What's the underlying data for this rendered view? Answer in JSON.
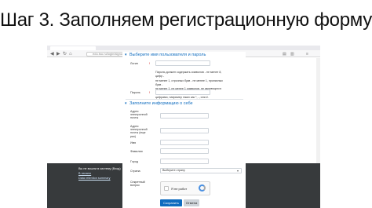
{
  "slide": {
    "title": "Шаг 3. Заполняем регистрационную форму"
  },
  "browser": {
    "url": "edu.tsu.ru/login/signup.php"
  },
  "sidebar": {
    "lines": [
      "Вы не вошли в систему (Вход)",
      "В начало",
      "Data retention summary"
    ]
  },
  "form": {
    "section1_title": "Выберите имя пользователя и пароль",
    "login_label": "Логин",
    "password_rules": [
      "Пароль должен содержать символов - не менее 8, цифр -",
      "не менее 1, строчных букв - не менее 1, прописных букв -",
      "не менее 1, не менее 1 символов, не являющихся буквами и",
      "цифрами, например таких как *, -, или #."
    ],
    "password_label": "Пароль",
    "section2_title": "Заполните информацию о себе",
    "email_label": "Адрес электронной почты",
    "email2_label": "Адрес электронной почты (еще раз)",
    "firstname_label": "Имя",
    "lastname_label": "Фамилия",
    "city_label": "Город",
    "country_label": "Страна",
    "country_placeholder": "Выберите страну",
    "captcha_label": "Секретный вопрос",
    "captcha_text": "Я не робот",
    "submit_label": "Сохранить",
    "cancel_label": "Отмена"
  },
  "colors": {
    "accent": "#0f6cbf",
    "sidebar_bg": "#373a3c"
  }
}
